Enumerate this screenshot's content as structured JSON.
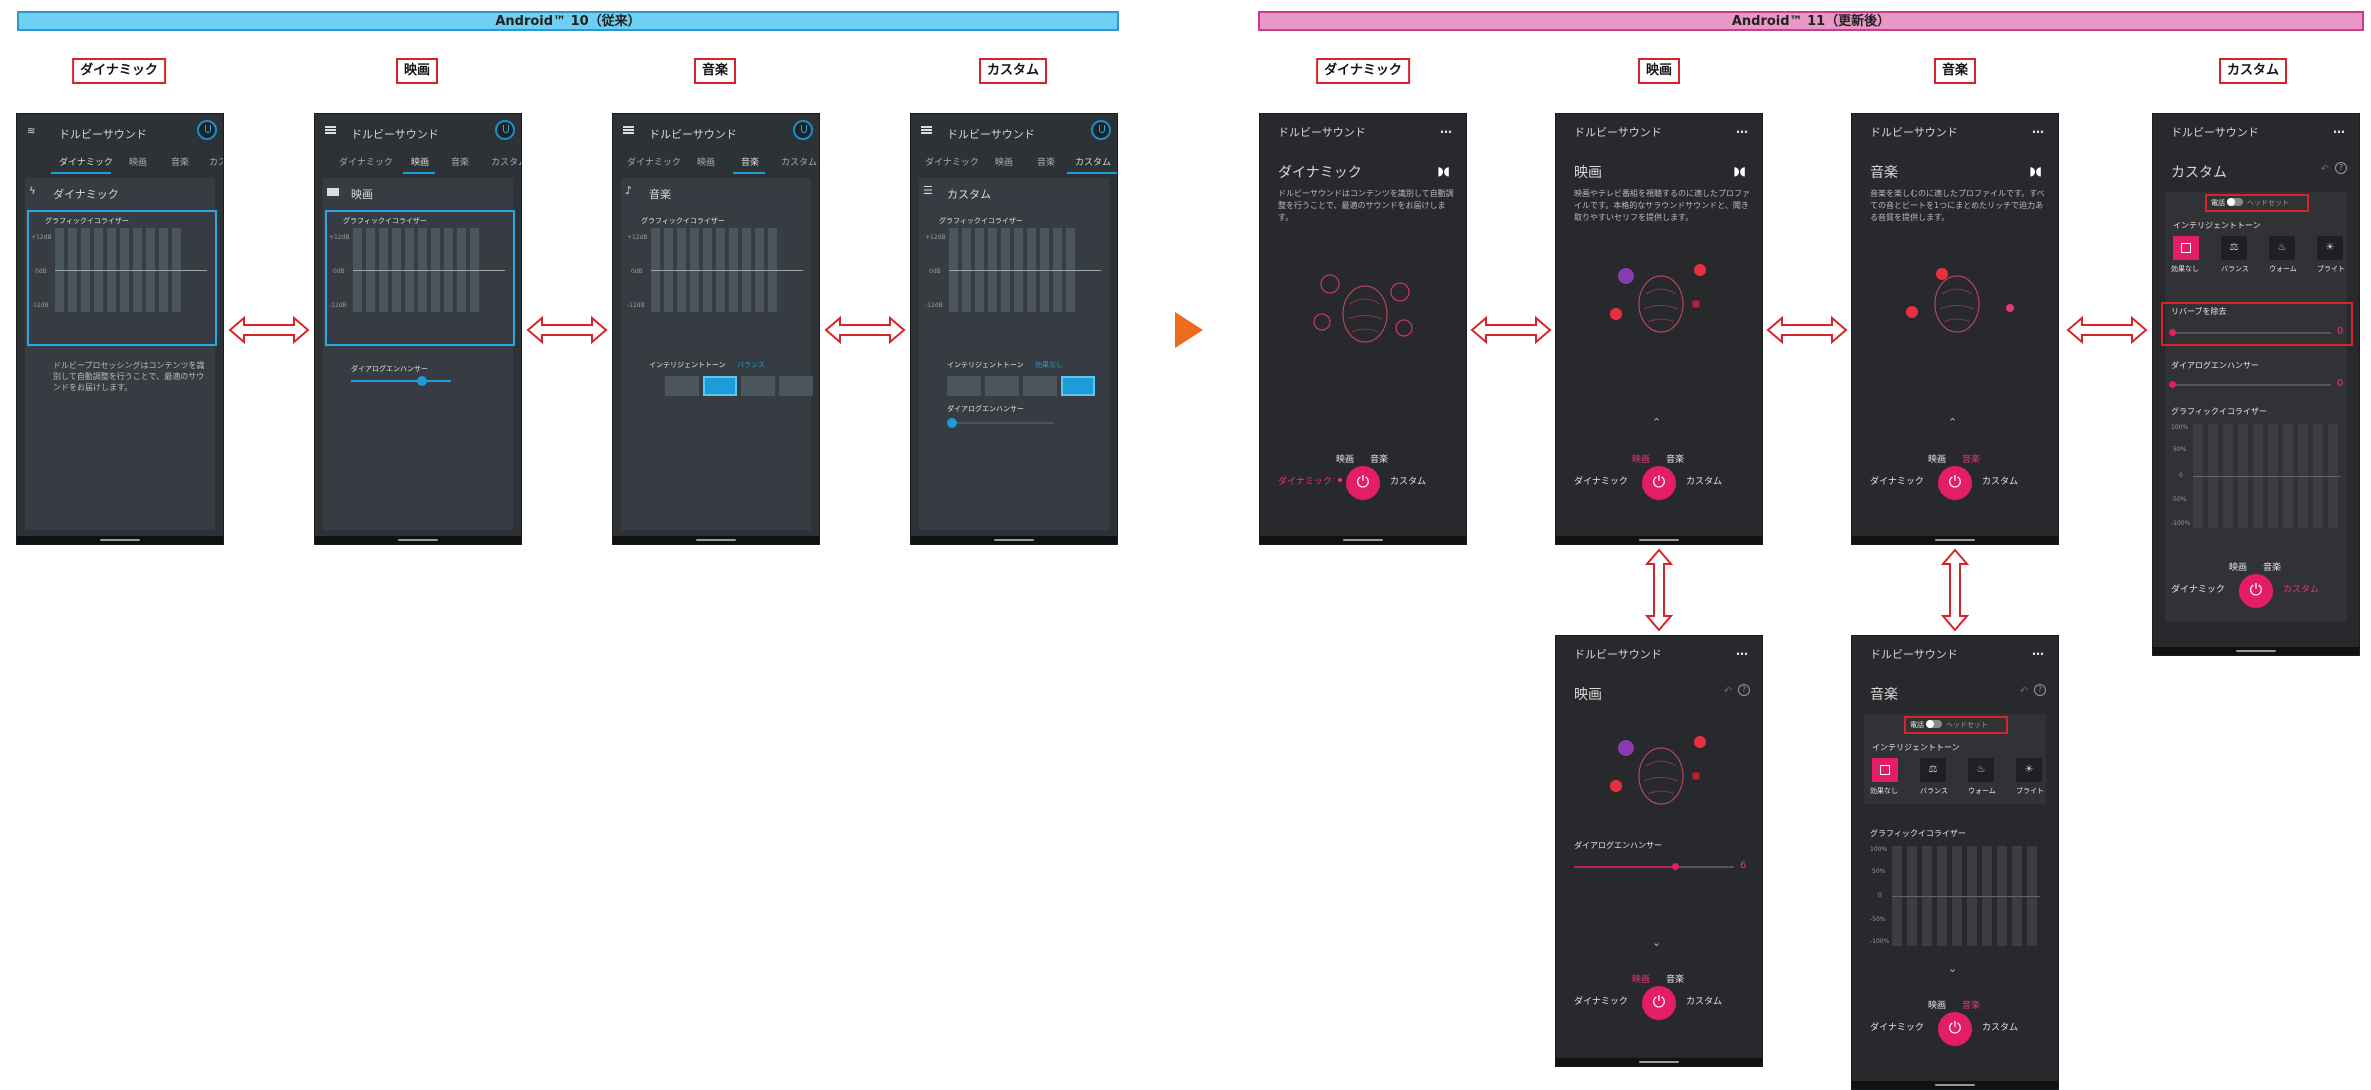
{
  "banners": {
    "a10": "Android™ 10（従来）",
    "a11": "Android™ 11（更新後）"
  },
  "labels": {
    "dynamic": "ダイナミック",
    "movie": "映画",
    "music": "音楽",
    "custom": "カスタム"
  },
  "app_title": "ドルビーサウンド",
  "menu_dots": "…",
  "tabs10": [
    "ダイナミック",
    "映画",
    "音楽",
    "カスタム"
  ],
  "a10": {
    "eq_title": "グラフィックイコライザー",
    "eq_top": "+12dB",
    "eq_mid": "0dB",
    "eq_bot": "-12dB",
    "dyn_desc": "ドルビープロセッシングはコンテンツを識別して自動調整を行うことで、最適のサウンドをお届けします。",
    "dialog": "ダイアログエンハンサー",
    "intelligent": "インテリジェントトーン",
    "tone_balance": "バランス",
    "tone_none": "効果なし"
  },
  "a11": {
    "dyn_desc": "ドルビーサウンドはコンテンツを識別して自動調整を行うことで、最適のサウンドをお届けします。",
    "movie_desc": "映画やテレビ番組を視聴するのに適したプロファイルです。本格的なサラウンドサウンドと、聞き取りやすいセリフを提供します。",
    "music_desc": "音楽を楽しむのに適したプロファイルです。すべての音とビートを1つにまとめたリッチで迫力ある音質を提供します。",
    "phone": "電話",
    "headset": "ヘッドセット",
    "intelligent": "インテリジェントトーン",
    "tones": [
      "効果なし",
      "バランス",
      "ウォーム",
      "ブライト"
    ],
    "reverb": "リバーブを除去",
    "dialog": "ダイアログエンハンサー",
    "eq_title": "グラフィックイコライザー",
    "eq_ticks": [
      "100%",
      "50%",
      "0",
      "-50%",
      "-100%"
    ],
    "zero": "0",
    "six": "6",
    "chevron_up": "⌃",
    "chevron_down": "⌄"
  },
  "colors": {
    "accent10": "#1c9cd8",
    "accent11": "#e41e64",
    "label_border": "#d8232a"
  }
}
